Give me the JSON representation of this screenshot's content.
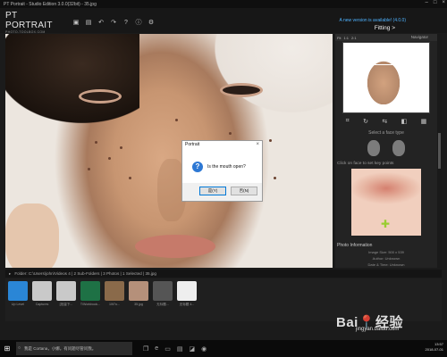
{
  "window": {
    "title": "PT Portrait - Studio Edition 3.0.0(32bit) - 35.jpg"
  },
  "header": {
    "logo_main": "PT PORTRAIT",
    "logo_sub": "PHOTO-TOOLBOX.COM",
    "update_text": "A new version is available! (4.0.0)",
    "mode_label": "Fitting >"
  },
  "dialog": {
    "title": "Portrait",
    "message": "Is the mouth open?",
    "yes_label": "是(Y)",
    "no_label": "否(N)"
  },
  "right_panel": {
    "navigator_label": "Navigator",
    "zoom_options": [
      "Fit",
      "1:1",
      "2:1"
    ],
    "face_type_label": "Select a face type",
    "key_points_label": "Click on face to set key points",
    "info_title": "Photo Information",
    "info_rows": [
      "Image Size: 500 x 539",
      "Author: Unknown",
      "Date & Time: Unknown"
    ]
  },
  "browser": {
    "path_text": "Folder:  C:\\Users\\john\\Videos 4 | 2 Sub-Folders | 3 Photos | 1 Selected | 35.jpg",
    "items": [
      {
        "name": "Up Level",
        "color": "#2a86d6"
      },
      {
        "name": "Captures",
        "color": "#c9c9c9"
      },
      {
        "name": "[批量下...",
        "color": "#c9c9c9"
      },
      {
        "name": "T\\Workbook...",
        "color": "#1e7145"
      },
      {
        "name": "10t7o...",
        "color": "#8a6a4a"
      },
      {
        "name": "35.jpg",
        "color": "#b5907a"
      },
      {
        "name": "无标题...",
        "color": "#555555"
      },
      {
        "name": "无标题 4...",
        "color": "#eeeeee"
      }
    ]
  },
  "taskbar": {
    "search_placeholder": "我是 Cortana，小娜。有问题尽管问我。",
    "time": "13:57",
    "date": "2018-07-01"
  },
  "watermark": {
    "main": "Bai📍经验",
    "sub": "jingyan.baidu.com"
  }
}
